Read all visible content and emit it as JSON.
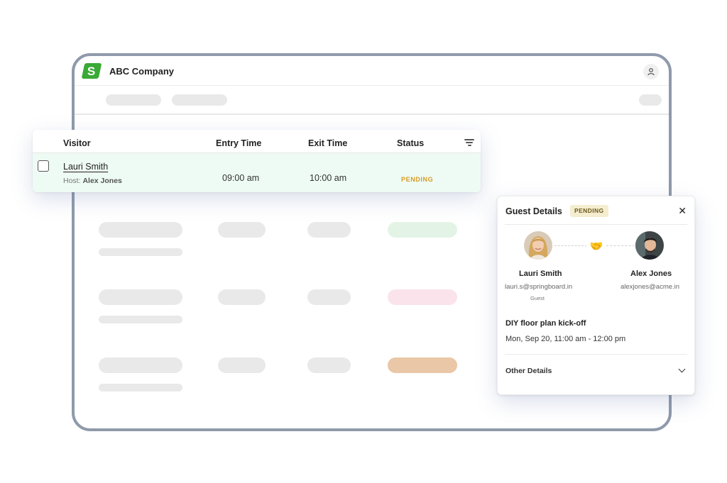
{
  "app": {
    "logo_letter": "S",
    "company_name": "ABC Company",
    "brand_color": "#3aa935"
  },
  "table": {
    "headers": [
      "Visitor",
      "Entry Time",
      "Exit Time",
      "Status"
    ],
    "row": {
      "visitor": "Lauri Smith",
      "host_label": "Host:",
      "host_name": "Alex Jones",
      "entry_time": "09:00 am",
      "exit_time": "10:00 am",
      "status": "PENDING"
    }
  },
  "panel": {
    "title": "Guest Details",
    "badge": "PENDING",
    "guest": {
      "name": "Lauri Smith",
      "email": "lauri.s@springboard.in",
      "role": "Guest"
    },
    "host": {
      "name": "Alex Jones",
      "email": "alexjones@acme.in"
    },
    "meeting_title": "DIY floor plan kick-off",
    "meeting_time": "Mon, Sep 20, 11:00 am - 12:00 pm",
    "other_details": "Other Details"
  },
  "colors": {
    "status_pending": "#d79b25",
    "row_highlight": "#eefbf4",
    "badge_bg": "#f5edcf",
    "skeleton_green": "#e3f4e6",
    "skeleton_pink": "#fae3ea",
    "skeleton_orange": "#eac7a6"
  }
}
